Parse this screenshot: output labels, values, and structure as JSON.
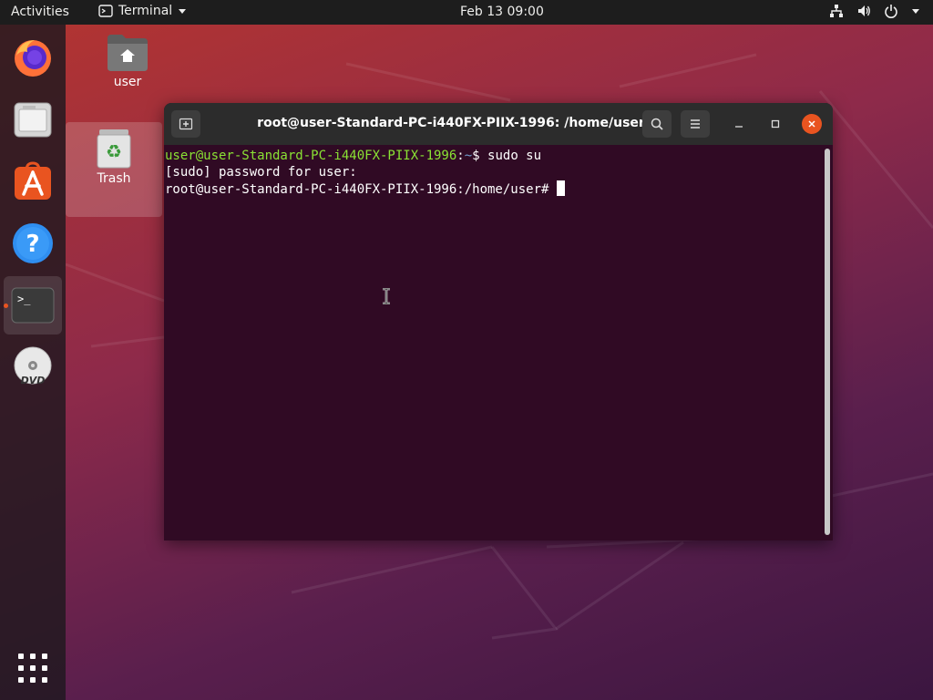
{
  "topbar": {
    "activities": "Activities",
    "app_name": "Terminal",
    "clock": "Feb 13  09:00"
  },
  "desktop": {
    "home_label": "user",
    "trash_label": "Trash"
  },
  "dock": {
    "items": [
      "firefox-icon",
      "files-icon",
      "software-icon",
      "help-icon",
      "terminal-icon",
      "dvd-icon"
    ]
  },
  "terminal": {
    "title": "root@user-Standard-PC-i440FX-PIIX-1996: /home/user",
    "line1_user": "user@user-Standard-PC-i440FX-PIIX-1996",
    "line1_colon": ":",
    "line1_path": "~",
    "line1_cmd": "$ sudo su",
    "line2": "[sudo] password for user:",
    "line3": "root@user-Standard-PC-i440FX-PIIX-1996:/home/user# "
  },
  "colors": {
    "accent": "#e95420",
    "terminal_bg": "#300a24",
    "prompt_green": "#8ae234",
    "prompt_blue": "#729fcf"
  }
}
